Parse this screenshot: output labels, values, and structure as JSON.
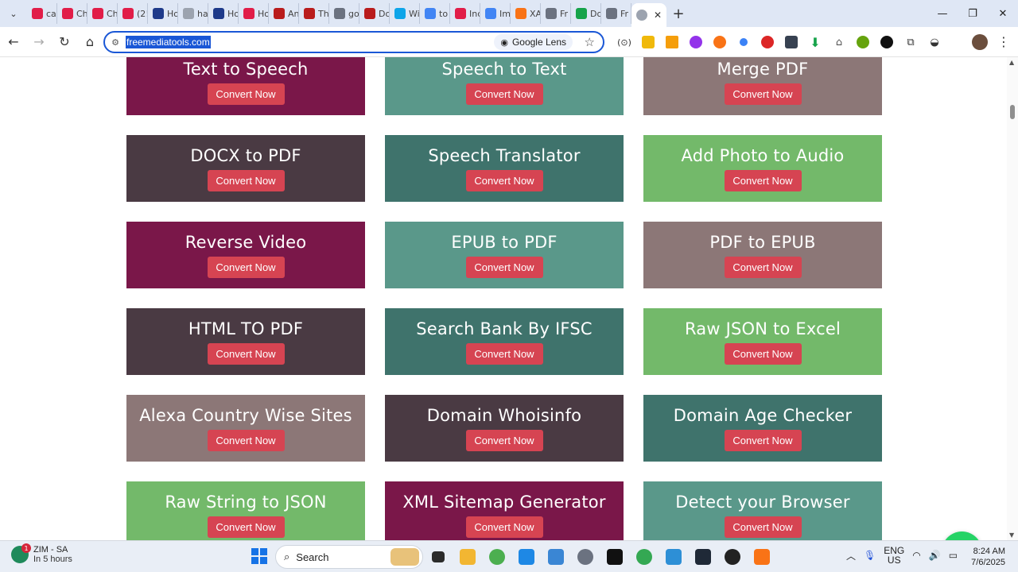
{
  "browser": {
    "tabs": [
      {
        "label": "ca",
        "color": "#e11d48"
      },
      {
        "label": "Ch",
        "color": "#e11d48"
      },
      {
        "label": "Ch",
        "color": "#e11d48"
      },
      {
        "label": "(2!",
        "color": "#e11d48"
      },
      {
        "label": "Ho",
        "color": "#1e3a8a"
      },
      {
        "label": "ha",
        "color": "#9ca3af"
      },
      {
        "label": "Ho",
        "color": "#1e3a8a"
      },
      {
        "label": "Ho",
        "color": "#e11d48"
      },
      {
        "label": "An",
        "color": "#b91c1c"
      },
      {
        "label": "Th",
        "color": "#b91c1c"
      },
      {
        "label": "go",
        "color": "#6b7280"
      },
      {
        "label": "Do",
        "color": "#b91c1c"
      },
      {
        "label": "Wi",
        "color": "#0ea5e9"
      },
      {
        "label": "to",
        "color": "#4285f4"
      },
      {
        "label": "Inc",
        "color": "#e11d48"
      },
      {
        "label": "Im",
        "color": "#4285f4"
      },
      {
        "label": "XA",
        "color": "#f97316"
      },
      {
        "label": "Fr",
        "color": "#6b7280"
      },
      {
        "label": "Do",
        "color": "#16a34a"
      },
      {
        "label": "Fr",
        "color": "#6b7280"
      }
    ],
    "active_tab_label": "",
    "address_url": "freemediatools.com",
    "lens_label": "Google Lens"
  },
  "tools": [
    {
      "title": "Text to Speech",
      "button": "Convert Now",
      "color": "#7a1749"
    },
    {
      "title": "Speech to Text",
      "button": "Convert Now",
      "color": "#5a988a"
    },
    {
      "title": "Merge PDF",
      "button": "Convert Now",
      "color": "#8c7777"
    },
    {
      "title": "DOCX to PDF",
      "button": "Convert Now",
      "color": "#4a3a43"
    },
    {
      "title": "Speech Translator",
      "button": "Convert Now",
      "color": "#3f736c"
    },
    {
      "title": "Add Photo to Audio",
      "button": "Convert Now",
      "color": "#73b96a"
    },
    {
      "title": "Reverse Video",
      "button": "Convert Now",
      "color": "#7a1749"
    },
    {
      "title": "EPUB to PDF",
      "button": "Convert Now",
      "color": "#5a988a"
    },
    {
      "title": "PDF to EPUB",
      "button": "Convert Now",
      "color": "#8c7777"
    },
    {
      "title": "HTML TO PDF",
      "button": "Convert Now",
      "color": "#4a3a43"
    },
    {
      "title": "Search Bank By IFSC",
      "button": "Convert Now",
      "color": "#3f736c"
    },
    {
      "title": "Raw JSON to Excel",
      "button": "Convert Now",
      "color": "#73b96a"
    },
    {
      "title": "Alexa Country Wise Sites",
      "button": "Convert Now",
      "color": "#8c7777"
    },
    {
      "title": "Domain Whoisinfo",
      "button": "Convert Now",
      "color": "#4a3a43"
    },
    {
      "title": "Domain Age Checker",
      "button": "Convert Now",
      "color": "#3f736c"
    },
    {
      "title": "Raw String to JSON",
      "button": "Convert Now",
      "color": "#73b96a"
    },
    {
      "title": "XML Sitemap Generator",
      "button": "Convert Now",
      "color": "#7a1749"
    },
    {
      "title": "Detect your Browser",
      "button": "Convert Now",
      "color": "#5a988a"
    }
  ],
  "taskbar": {
    "weather_title": "ZIM - SA",
    "weather_sub": "In 5 hours",
    "weather_badge": "1",
    "search_label": "Search",
    "lang_top": "ENG",
    "lang_bottom": "US",
    "time": "8:24 AM",
    "date": "7/6/2025"
  }
}
